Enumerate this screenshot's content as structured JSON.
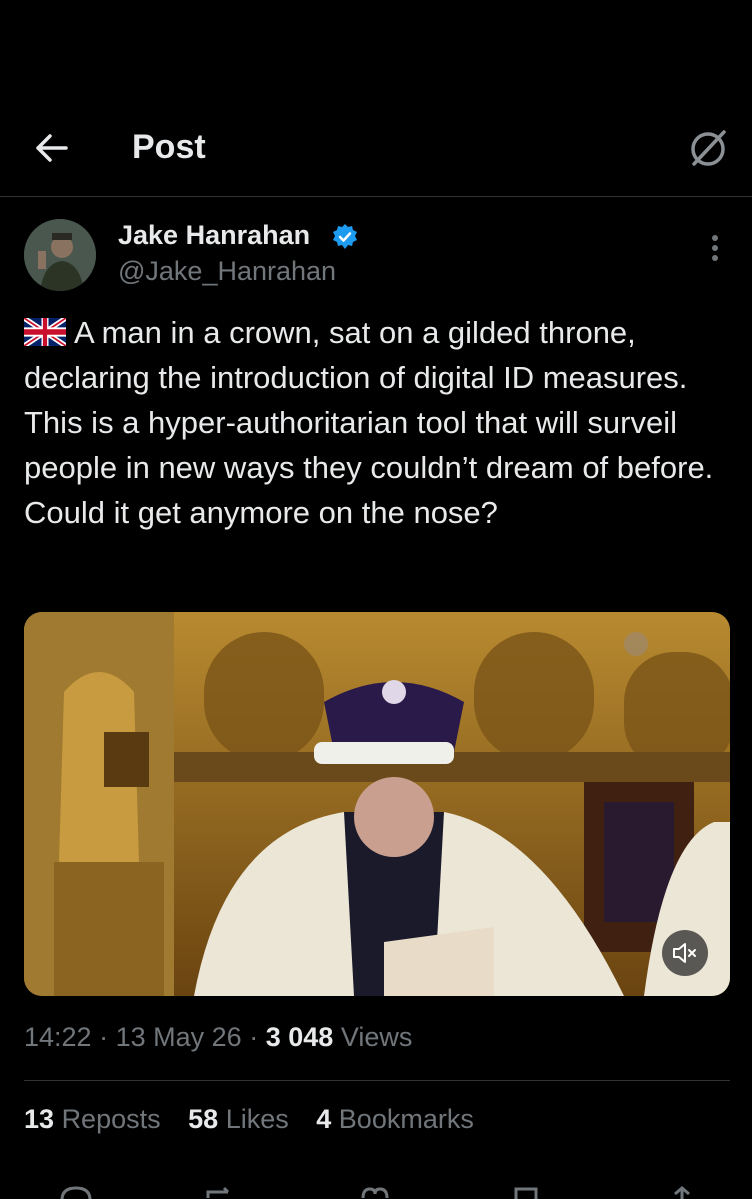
{
  "header": {
    "title": "Post"
  },
  "post": {
    "author": {
      "name": "Jake Hanrahan",
      "handle": "@Jake_Hanrahan",
      "verified_color": "#1d9bf0"
    },
    "text": "A man in a crown, sat on a gilded throne, declaring the introduction of digital ID measures. This is a hyper-authoritarian tool that will surveil people in new ways they couldn’t dream of before. Could it get anymore on the nose?",
    "time": "14:22",
    "date": "13 May 26",
    "separator": "·",
    "views_count": "3 048",
    "views_label": "Views",
    "stats": {
      "reposts_count": "13",
      "reposts_label": "Reposts",
      "likes_count": "58",
      "likes_label": "Likes",
      "bookmarks_count": "4",
      "bookmarks_label": "Bookmarks"
    }
  },
  "icons": {
    "back": "arrow-left-icon",
    "grok": "grok-icon",
    "more": "more-vertical-icon",
    "verified": "verified-badge-icon",
    "flag": "uk-flag-icon",
    "mute": "volume-muted-icon",
    "reply": "reply-icon",
    "repost": "repost-icon",
    "like": "heart-icon",
    "bookmark": "bookmark-icon",
    "share": "share-icon"
  },
  "colors": {
    "background": "#000000",
    "text": "#e7e9ea",
    "secondary": "#71767b",
    "divider": "#2f3336",
    "accent": "#1d9bf0"
  }
}
